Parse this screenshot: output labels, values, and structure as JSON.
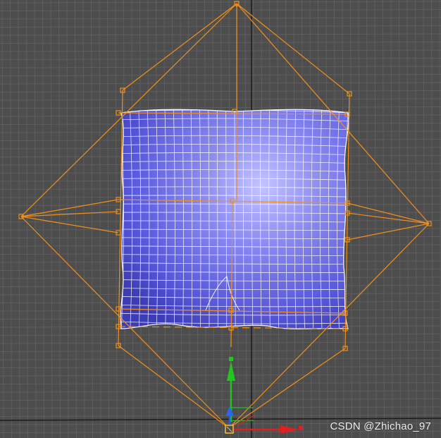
{
  "viewport": {
    "watermark": "CSDN @Zhichao_97",
    "colors": {
      "background": "#4d4d4d",
      "grid": "#5e5e5e",
      "grid_axis": "#1a1a1a",
      "cage": "#f0901c",
      "mesh": "#6a6ae8",
      "wire": "#ffffff",
      "axis_x": "#e02020",
      "axis_y": "#20c020",
      "axis_z": "#2060e0"
    },
    "object": "cushion-mesh",
    "gizmo": "transform-gizmo"
  }
}
